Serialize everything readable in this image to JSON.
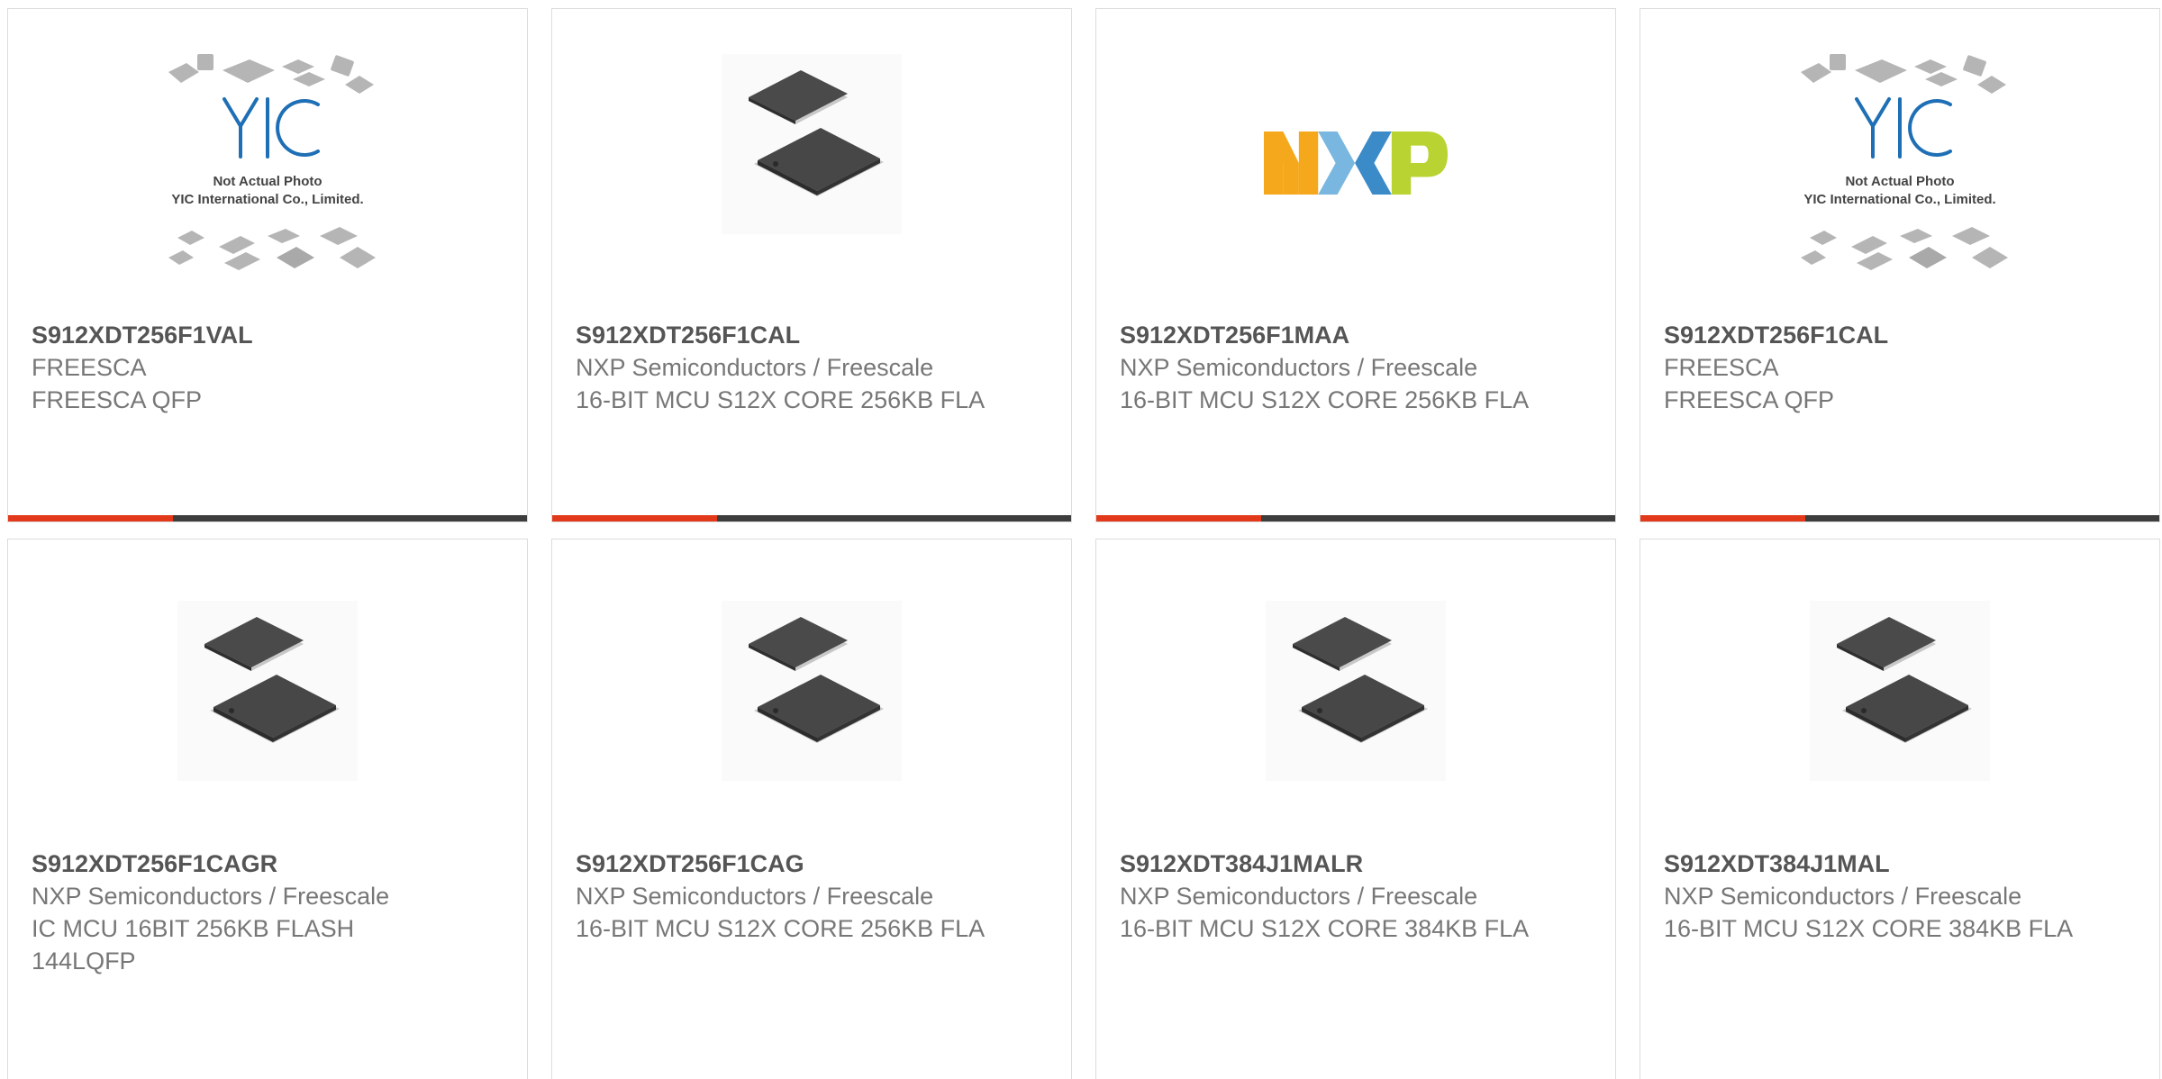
{
  "products": [
    {
      "part": "S912XDT256F1VAL",
      "maker": "FREESCA",
      "desc": "FREESCA QFP",
      "image": "yic-placeholder",
      "image_text": [
        "Not Actual Photo",
        "YIC International Co., Limited."
      ]
    },
    {
      "part": "S912XDT256F1CAL",
      "maker": "NXP Semiconductors / Freescale",
      "desc": "16-BIT MCU S12X CORE 256KB FLA",
      "image": "qfp-chip"
    },
    {
      "part": "S912XDT256F1MAA",
      "maker": "NXP Semiconductors / Freescale",
      "desc": "16-BIT MCU S12X CORE 256KB FLA",
      "image": "nxp-logo"
    },
    {
      "part": "S912XDT256F1CAL",
      "maker": "FREESCA",
      "desc": "FREESCA QFP",
      "image": "yic-placeholder",
      "image_text": [
        "Not Actual Photo",
        "YIC International Co., Limited."
      ]
    },
    {
      "part": "S912XDT256F1CAGR",
      "maker": "NXP Semiconductors / Freescale",
      "desc": "IC MCU 16BIT 256KB FLASH 144LQFP",
      "image": "qfp-chip"
    },
    {
      "part": "S912XDT256F1CAG",
      "maker": "NXP Semiconductors / Freescale",
      "desc": "16-BIT MCU S12X CORE 256KB FLA",
      "image": "qfp-chip"
    },
    {
      "part": "S912XDT384J1MALR",
      "maker": "NXP Semiconductors / Freescale",
      "desc": "16-BIT MCU S12X CORE 384KB FLA",
      "image": "qfp-chip"
    },
    {
      "part": "S912XDT384J1MAL",
      "maker": "NXP Semiconductors / Freescale",
      "desc": "16-BIT MCU S12X CORE 384KB FLA",
      "image": "qfp-chip"
    }
  ],
  "colors": {
    "accent": "#e2391b",
    "bar_dark": "#3d3d3d",
    "part_text": "#555555",
    "body_text": "#777777",
    "border": "#dcdcdc"
  }
}
